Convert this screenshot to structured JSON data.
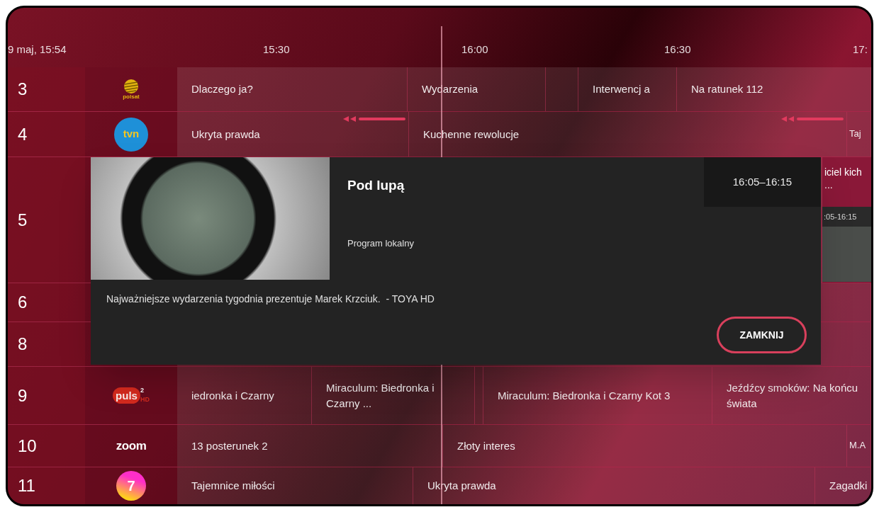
{
  "header": {
    "clock": "9 maj, 15:54",
    "ticks": [
      "15:30",
      "16:00",
      "16:30",
      "17:"
    ]
  },
  "rows": [
    {
      "number": "3",
      "logo": {
        "kind": "globe",
        "text": "polsat"
      },
      "cells": [
        {
          "kind": "program",
          "title": "Dlaczego ja?",
          "catchup": false
        },
        {
          "kind": "program",
          "title": "Wydarzenia",
          "catchup": false
        },
        {
          "kind": "slot"
        },
        {
          "kind": "program",
          "title": "Interwencj a",
          "catchup": false
        },
        {
          "kind": "program",
          "title": "Na ratunek 112",
          "catchup": false
        }
      ]
    },
    {
      "number": "4",
      "logo": {
        "kind": "badge",
        "text": "tvn"
      },
      "cells": [
        {
          "kind": "program",
          "title": "Ukryta prawda",
          "catchup": true
        },
        {
          "kind": "program",
          "title": "Kuchenne rewolucje",
          "catchup": true
        },
        {
          "kind": "program",
          "title": "Taj",
          "catchup": false
        }
      ]
    },
    {
      "number": "5",
      "cells": [
        {
          "kind": "slot"
        },
        {
          "kind": "preview",
          "title": "iciel kich ...",
          "time": ":05-16:15"
        }
      ]
    },
    {
      "number": "6",
      "cells": [
        {
          "kind": "slot"
        }
      ]
    },
    {
      "number": "8",
      "cells": [
        {
          "kind": "slot"
        }
      ]
    },
    {
      "number": "9",
      "logo": {
        "kind": "blob",
        "text": "puls",
        "sup": "2",
        "tag": "HD"
      },
      "cells": [
        {
          "kind": "program",
          "title": "iedronka i Czarny",
          "catchup": false
        },
        {
          "kind": "program",
          "title": "Miraculum: Biedronka i Czarny ...",
          "catchup": false
        },
        {
          "kind": "slot"
        },
        {
          "kind": "program",
          "title": "Miraculum: Biedronka i Czarny Kot 3",
          "catchup": false
        },
        {
          "kind": "program",
          "title": "Jeźdźcy smoków: Na końcu świata",
          "catchup": false
        }
      ]
    },
    {
      "number": "10",
      "logo": {
        "kind": "word",
        "text": "zoom"
      },
      "cells": [
        {
          "kind": "program",
          "title": "13 posterunek 2",
          "catchup": false
        },
        {
          "kind": "program",
          "title": "Złoty interes",
          "catchup": false
        },
        {
          "kind": "program",
          "title": "M.A",
          "catchup": false
        }
      ]
    },
    {
      "number": "11",
      "logo": {
        "kind": "ring",
        "text": "7"
      },
      "cells": [
        {
          "kind": "program",
          "title": "Tajemnice miłości",
          "catchup": false
        },
        {
          "kind": "program",
          "title": "Ukryta prawda",
          "catchup": false
        },
        {
          "kind": "program",
          "title": "Zagadki",
          "catchup": false
        }
      ]
    }
  ],
  "dialog": {
    "title": "Pod lupą",
    "time": "16:05–16:15",
    "genre": "Program lokalny",
    "description": "Najważniejsze wydarzenia tygodnia prezentuje Marek Krzciuk.  - TOYA HD",
    "button": "ZAMKNIJ"
  }
}
